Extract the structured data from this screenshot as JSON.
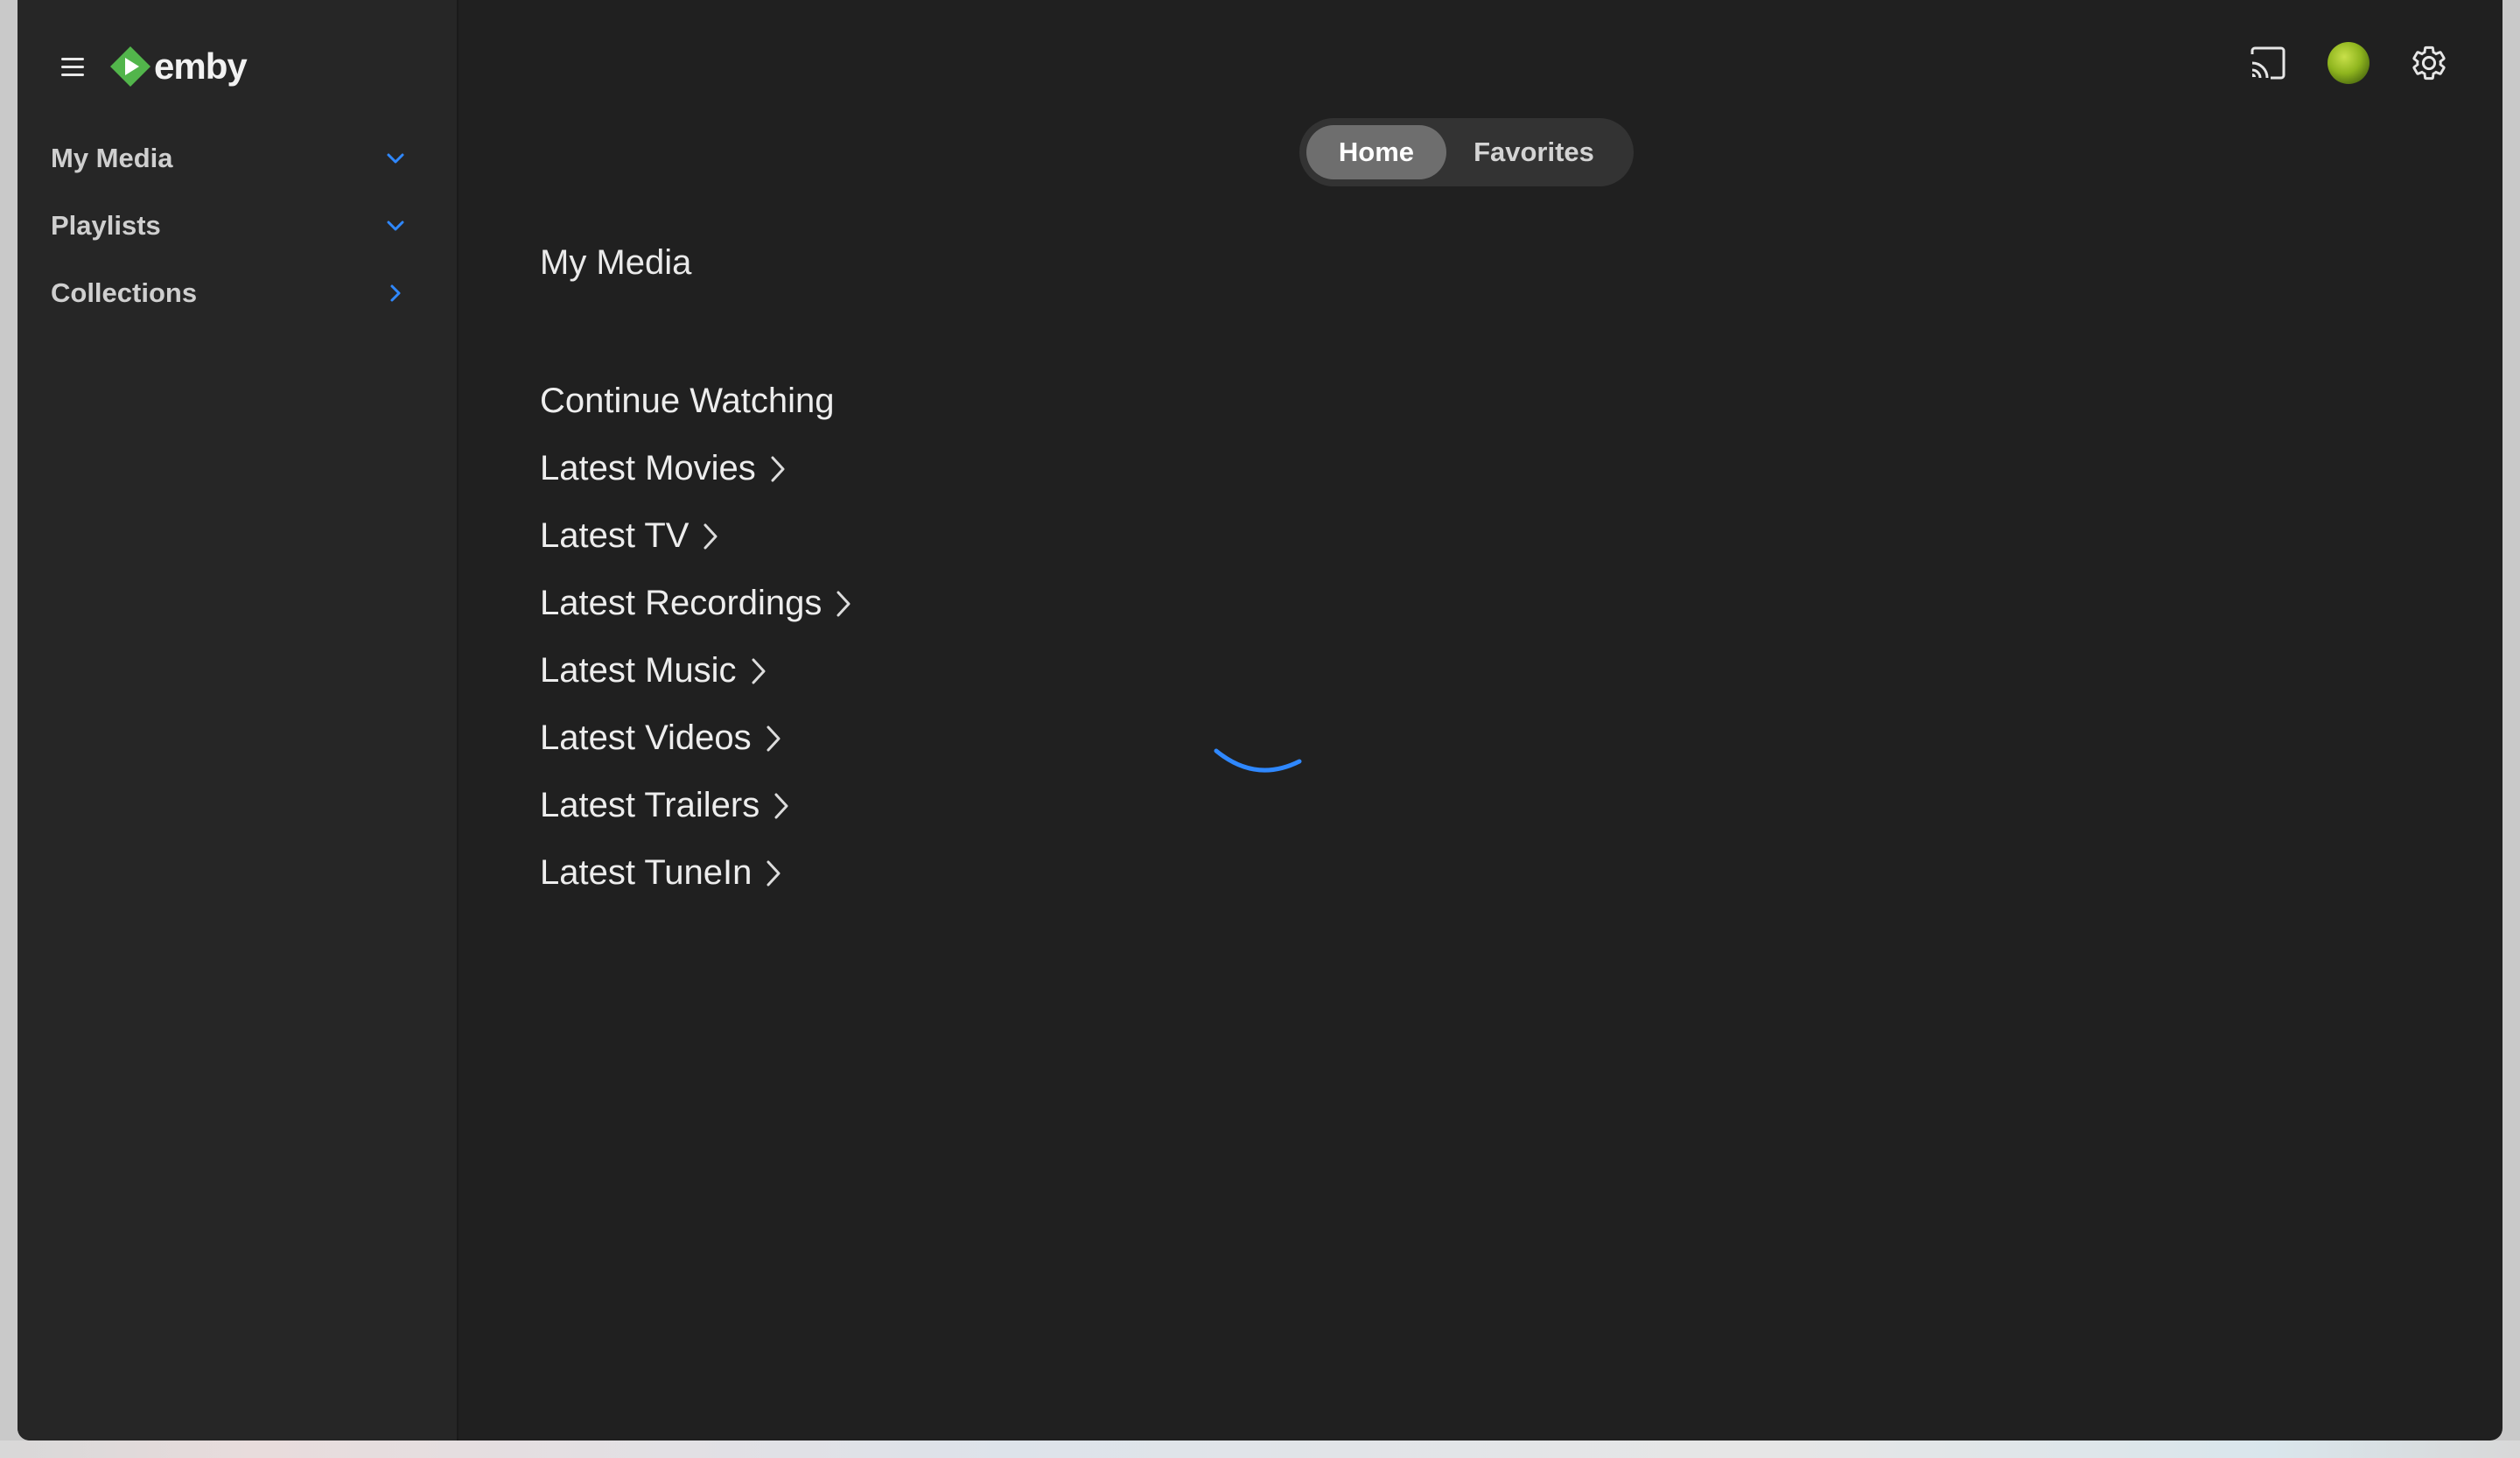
{
  "brand": {
    "name": "emby",
    "logo_color": "#52b54b"
  },
  "sidebar": {
    "items": [
      {
        "label": "My Media",
        "chevron": "chevron-down"
      },
      {
        "label": "Playlists",
        "chevron": "chevron-down"
      },
      {
        "label": "Collections",
        "chevron": "chevron-right"
      }
    ],
    "chevron_color": "#2f88ff"
  },
  "header": {
    "icons": [
      "cast-icon",
      "avatar",
      "gear-icon"
    ]
  },
  "tabs": [
    {
      "label": "Home",
      "active": true
    },
    {
      "label": "Favorites",
      "active": false
    }
  ],
  "main": {
    "title": "My Media",
    "sections": [
      {
        "label": "Continue Watching",
        "has_link": false
      },
      {
        "label": "Latest Movies",
        "has_link": true
      },
      {
        "label": "Latest TV",
        "has_link": true
      },
      {
        "label": "Latest Recordings",
        "has_link": true
      },
      {
        "label": "Latest Music",
        "has_link": true
      },
      {
        "label": "Latest Videos",
        "has_link": true
      },
      {
        "label": "Latest Trailers",
        "has_link": true
      },
      {
        "label": "Latest TuneIn",
        "has_link": true
      }
    ]
  },
  "loading": {
    "spinner_color": "#2f88ff"
  }
}
